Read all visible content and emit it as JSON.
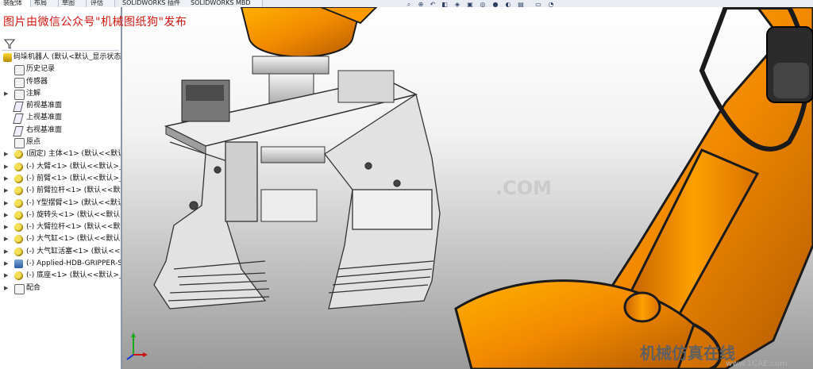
{
  "tabs": [
    "装配体",
    "布局",
    "草图",
    "评估",
    "SOLIDWORKS 插件",
    "SOLIDWORKS MBD"
  ],
  "watermark": {
    "top_left": "图片由微信公众号\"机械图纸狗\"发布",
    "center": ".COM",
    "bottom_brand": "机械仿真在线",
    "bottom_url": "www.1CAE.com"
  },
  "tree": {
    "root": "码垛机器人 (默认<默认_显示状态-1",
    "items": [
      {
        "label": "历史记录",
        "icon": "history-icon",
        "expand": false
      },
      {
        "label": "传感器",
        "icon": "sensor-icon",
        "expand": false
      },
      {
        "label": "注解",
        "icon": "annotation-icon",
        "expand": true
      },
      {
        "label": "前视基准面",
        "icon": "plane-icon",
        "expand": false
      },
      {
        "label": "上视基准面",
        "icon": "plane-icon",
        "expand": false
      },
      {
        "label": "右视基准面",
        "icon": "plane-icon",
        "expand": false
      },
      {
        "label": "原点",
        "icon": "origin-icon",
        "expand": false
      },
      {
        "label": "(固定) 主体<1> (默认<<默认>_",
        "icon": "part-icon",
        "expand": true
      },
      {
        "label": "(-) 大臂<1> (默认<<默认>_显",
        "icon": "part-icon",
        "expand": true
      },
      {
        "label": "(-) 前臂<1> (默认<<默认>_显",
        "icon": "part-icon",
        "expand": true
      },
      {
        "label": "(-) 前臂拉杆<1> (默认<<默认>",
        "icon": "part-icon",
        "expand": true
      },
      {
        "label": "(-) Y型摆臂<1> (默认<<默认>",
        "icon": "part-icon",
        "expand": true
      },
      {
        "label": "(-) 旋转头<1> (默认<<默认>_",
        "icon": "part-icon",
        "expand": true
      },
      {
        "label": "(-) 大臂拉杆<1> (默认<<默认>",
        "icon": "part-icon",
        "expand": true
      },
      {
        "label": "(-) 大气缸<1> (默认<<默认>_",
        "icon": "part-icon",
        "expand": true
      },
      {
        "label": "(-) 大气缸活塞<1> (默认<<默认",
        "icon": "part-icon",
        "expand": true
      },
      {
        "label": "(-) Applied-HDB-GRIPPER-SS",
        "icon": "assembly-icon",
        "expand": true
      },
      {
        "label": "(-) 底座<1> (默认<<默认>_显",
        "icon": "part-icon",
        "expand": true
      },
      {
        "label": "配合",
        "icon": "mates-icon",
        "expand": true
      }
    ]
  },
  "colors": {
    "robot_orange": "#f28a00",
    "robot_dark": "#2b2b2b",
    "gripper_gray": "#d9d9d9",
    "watermark_red": "#d2160e"
  }
}
